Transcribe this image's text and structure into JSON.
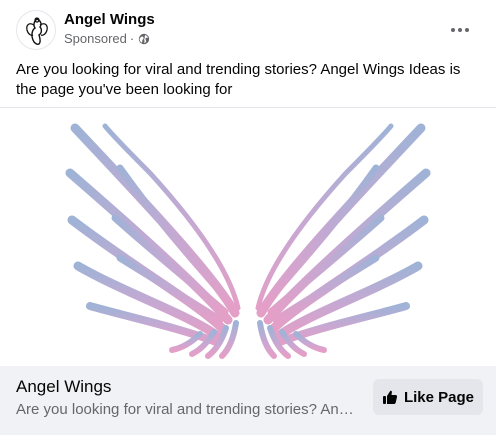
{
  "post": {
    "page_name": "Angel Wings",
    "sponsored_label": "Sponsored",
    "separator": "·",
    "text": "Are you looking for viral and trending stories? Angel Wings Ideas is the page you've been looking for"
  },
  "link_card": {
    "title": "Angel Wings",
    "description": "Are you looking for viral and trending stories? Angel Wings Ideas is the page you've been looking for",
    "like_button_label": "Like Page"
  },
  "icons": {
    "avatar": "angel-silhouette-logo",
    "audience": "globe-icon",
    "more": "more-options-icon",
    "like": "thumbs-up-icon"
  },
  "colors": {
    "wing_top": "#9fb3d6",
    "wing_bottom": "#e49fc7",
    "secondary_text": "#65676b",
    "button_bg": "#e4e6eb"
  }
}
